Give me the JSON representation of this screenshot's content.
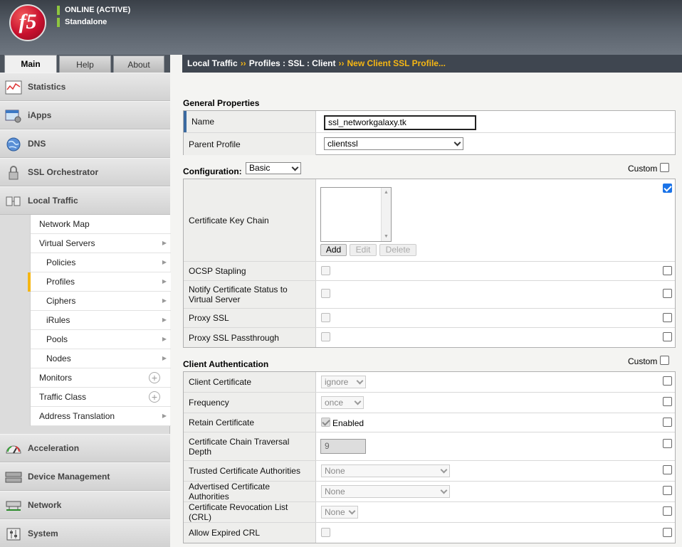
{
  "header": {
    "logo_text": "f5",
    "status_line1": "ONLINE (ACTIVE)",
    "status_line2": "Standalone",
    "status_color": "#8ec63f"
  },
  "tabs": [
    {
      "label": "Main",
      "active": true
    },
    {
      "label": "Help",
      "active": false
    },
    {
      "label": "About",
      "active": false
    }
  ],
  "breadcrumb": {
    "part1": "Local Traffic",
    "sep": "››",
    "part2": "Profiles : SSL : Client",
    "current": "New Client SSL Profile..."
  },
  "sidebar": {
    "sections": [
      {
        "label": "Statistics",
        "icon": "statistics-icon"
      },
      {
        "label": "iApps",
        "icon": "iapps-icon"
      },
      {
        "label": "DNS",
        "icon": "globe-icon"
      },
      {
        "label": "SSL Orchestrator",
        "icon": "lock-icon"
      },
      {
        "label": "Local Traffic",
        "icon": "local-traffic-icon"
      },
      {
        "label": "Acceleration",
        "icon": "gauge-icon"
      },
      {
        "label": "Device Management",
        "icon": "device-icon"
      },
      {
        "label": "Network",
        "icon": "network-icon"
      },
      {
        "label": "System",
        "icon": "system-icon"
      }
    ],
    "local_traffic_items": [
      {
        "label": "Network Map"
      },
      {
        "label": "Virtual Servers"
      },
      {
        "label": "Policies"
      },
      {
        "label": "Profiles"
      },
      {
        "label": "Ciphers"
      },
      {
        "label": "iRules"
      },
      {
        "label": "Pools"
      },
      {
        "label": "Nodes"
      },
      {
        "label": "Monitors"
      },
      {
        "label": "Traffic Class"
      },
      {
        "label": "Address Translation"
      }
    ],
    "accent_color": "#f5b614"
  },
  "general": {
    "heading": "General Properties",
    "name_label": "Name",
    "name_value": "ssl_networkgalaxy.tk",
    "parent_label": "Parent Profile",
    "parent_value": "clientssl"
  },
  "config": {
    "heading": "Configuration:",
    "mode": "Basic",
    "custom_label": "Custom",
    "cert_key_chain_label": "Certificate Key Chain",
    "add": "Add",
    "edit": "Edit",
    "delete": "Delete",
    "ocsp_label": "OCSP Stapling",
    "notify_label": "Notify Certificate Status to Virtual Server",
    "proxy_ssl_label": "Proxy SSL",
    "proxy_pass_label": "Proxy SSL Passthrough"
  },
  "client_auth": {
    "heading": "Client Authentication",
    "custom_label": "Custom",
    "client_cert_label": "Client Certificate",
    "client_cert_value": "ignore",
    "frequency_label": "Frequency",
    "frequency_value": "once",
    "retain_label": "Retain Certificate",
    "retain_value": "Enabled",
    "depth_label": "Certificate Chain Traversal Depth",
    "depth_value": "9",
    "trusted_label": "Trusted Certificate Authorities",
    "trusted_value": "None",
    "advertised_label": "Advertised Certificate Authorities",
    "advertised_value": "None",
    "crl_label": "Certificate Revocation List (CRL)",
    "crl_value": "None",
    "expired_crl_label": "Allow Expired CRL"
  }
}
